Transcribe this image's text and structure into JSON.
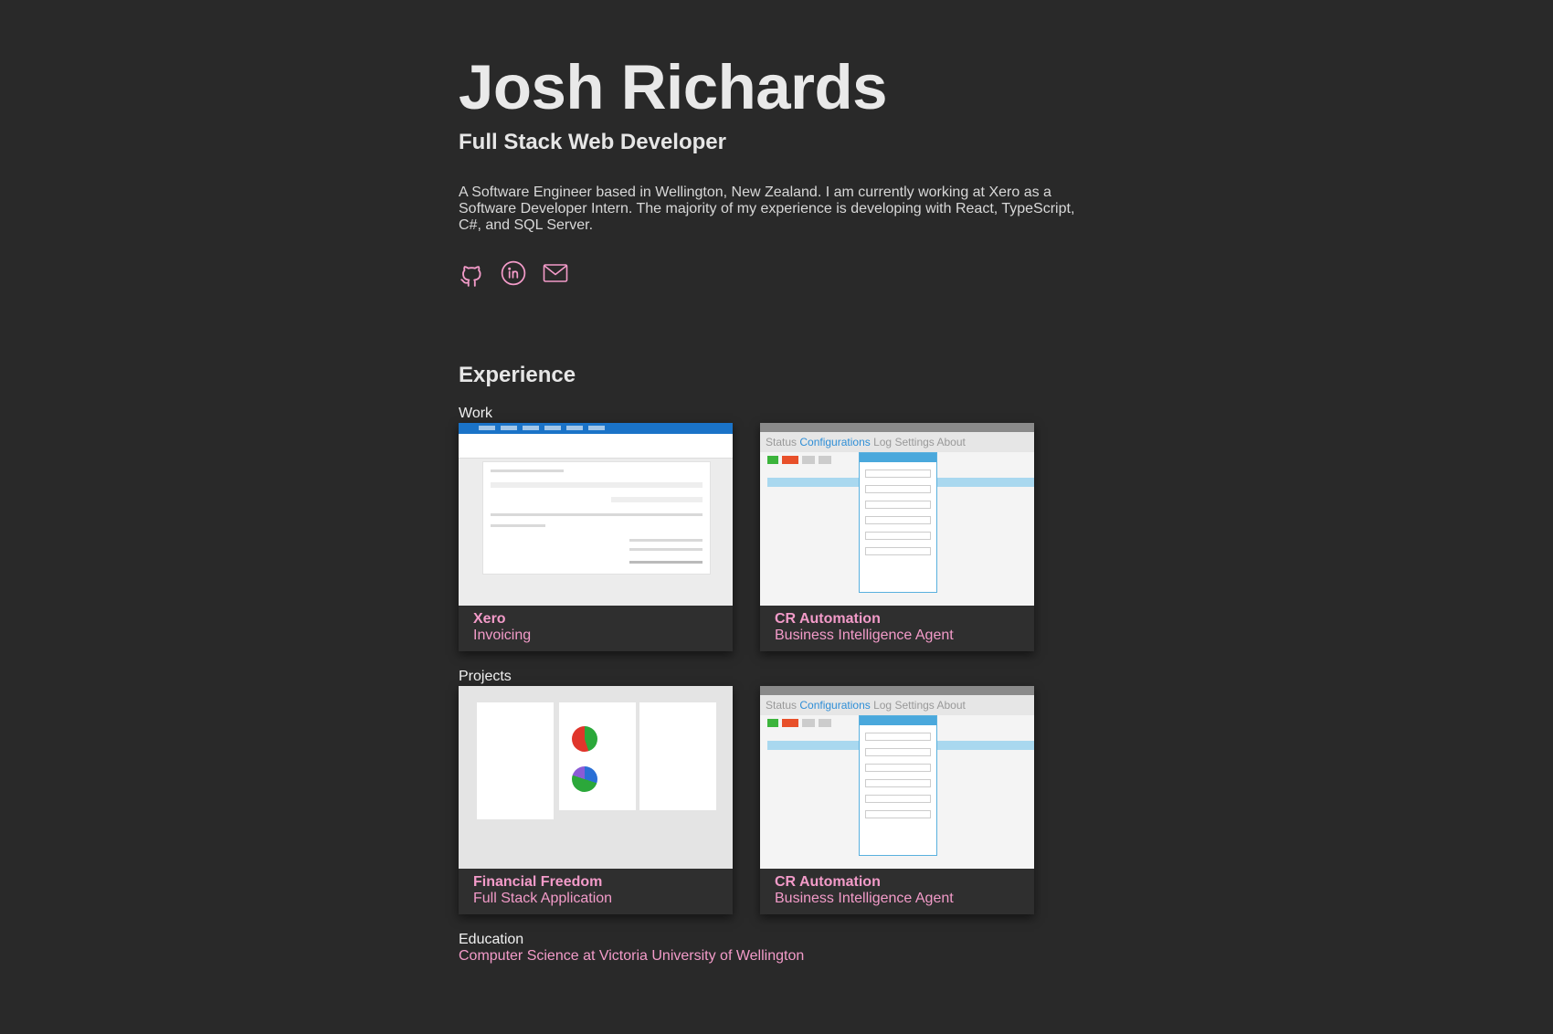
{
  "header": {
    "name": "Josh Richards",
    "role": "Full Stack Web Developer",
    "bio": "A Software Engineer based in Wellington, New Zealand. I am currently working at Xero as a Software Developer Intern. The majority of my experience is developing with React, TypeScript, C#, and SQL Server."
  },
  "socials": [
    {
      "icon": "github-icon"
    },
    {
      "icon": "linkedin-icon"
    },
    {
      "icon": "mail-icon"
    }
  ],
  "accent_color": "#f39bc9",
  "background_color": "#292929",
  "experience": {
    "title": "Experience",
    "work": {
      "label": "Work",
      "cards": [
        {
          "title": "Xero",
          "subtitle": "Invoicing"
        },
        {
          "title": "CR Automation",
          "subtitle": "Business Intelligence Agent"
        }
      ]
    },
    "projects": {
      "label": "Projects",
      "cards": [
        {
          "title": "Financial Freedom",
          "subtitle": "Full Stack Application"
        },
        {
          "title": "CR Automation",
          "subtitle": "Business Intelligence Agent"
        }
      ]
    },
    "education": {
      "label": "Education",
      "value": "Computer Science at Victoria University of Wellington"
    }
  }
}
